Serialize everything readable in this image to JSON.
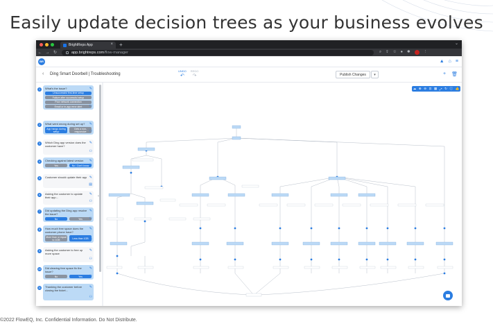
{
  "slide": {
    "title": "Easily update decision trees as your business evolves",
    "footer": "©2022 FlowEQ, Inc. Confidential Information. Do Not Distribute."
  },
  "browser": {
    "tab_title": "BrightReps App",
    "url_host": "app.brightreps.com",
    "url_path": "/flow-manager",
    "new_tab": "+",
    "tab_close": "×"
  },
  "app": {
    "logo_text": "BR",
    "flow_title": "Ding Smart Doorbell | Troubleshooting",
    "undo_label": "UNDO",
    "redo_label": "REDO",
    "publish_label": "Publish Changes"
  },
  "sidebar": {
    "items": [
      {
        "num": "1",
        "text": "What's the issue?"
      },
      {
        "num": "2",
        "text": "What went wrong during set up?"
      },
      {
        "num": "3",
        "text": "Which Ding app version does the customer have?"
      },
      {
        "num": "4",
        "text": "Checking against latest version"
      },
      {
        "num": "5",
        "text": "Customer should update their app"
      },
      {
        "num": "6",
        "text": "Asking the customer to update their app..."
      },
      {
        "num": "7",
        "text": "Did updating the Ding app resolve the issue?"
      },
      {
        "num": "8",
        "text": "How much free space does the customer phone have?"
      },
      {
        "num": "9",
        "text": "Asking the customer to free up more space"
      },
      {
        "num": "10",
        "text": "Did clearing free space fix the issue?"
      },
      {
        "num": "11",
        "text": "Thanking the customer before closing the ticket..."
      }
    ],
    "q1_options": [
      "Unsuccessful first-time setup",
      "Failure after successful setup",
      "Poor network connection",
      "Email or in-app error alert"
    ],
    "q2_options": [
      "App hangs during setup",
      "Gets a non-responsive"
    ],
    "q4_options": [
      "Yes",
      "No / Don't know"
    ],
    "q7_options": [
      "No",
      "Yes"
    ],
    "q8_options": [
      "More than or equal to 1GB",
      "Less than 1GB"
    ],
    "q10_options": [
      "No",
      "Yes"
    ]
  },
  "colors": {
    "accent": "#2b7de1",
    "card_active": "#bcdaf6",
    "option_grey": "#8a93a0"
  }
}
